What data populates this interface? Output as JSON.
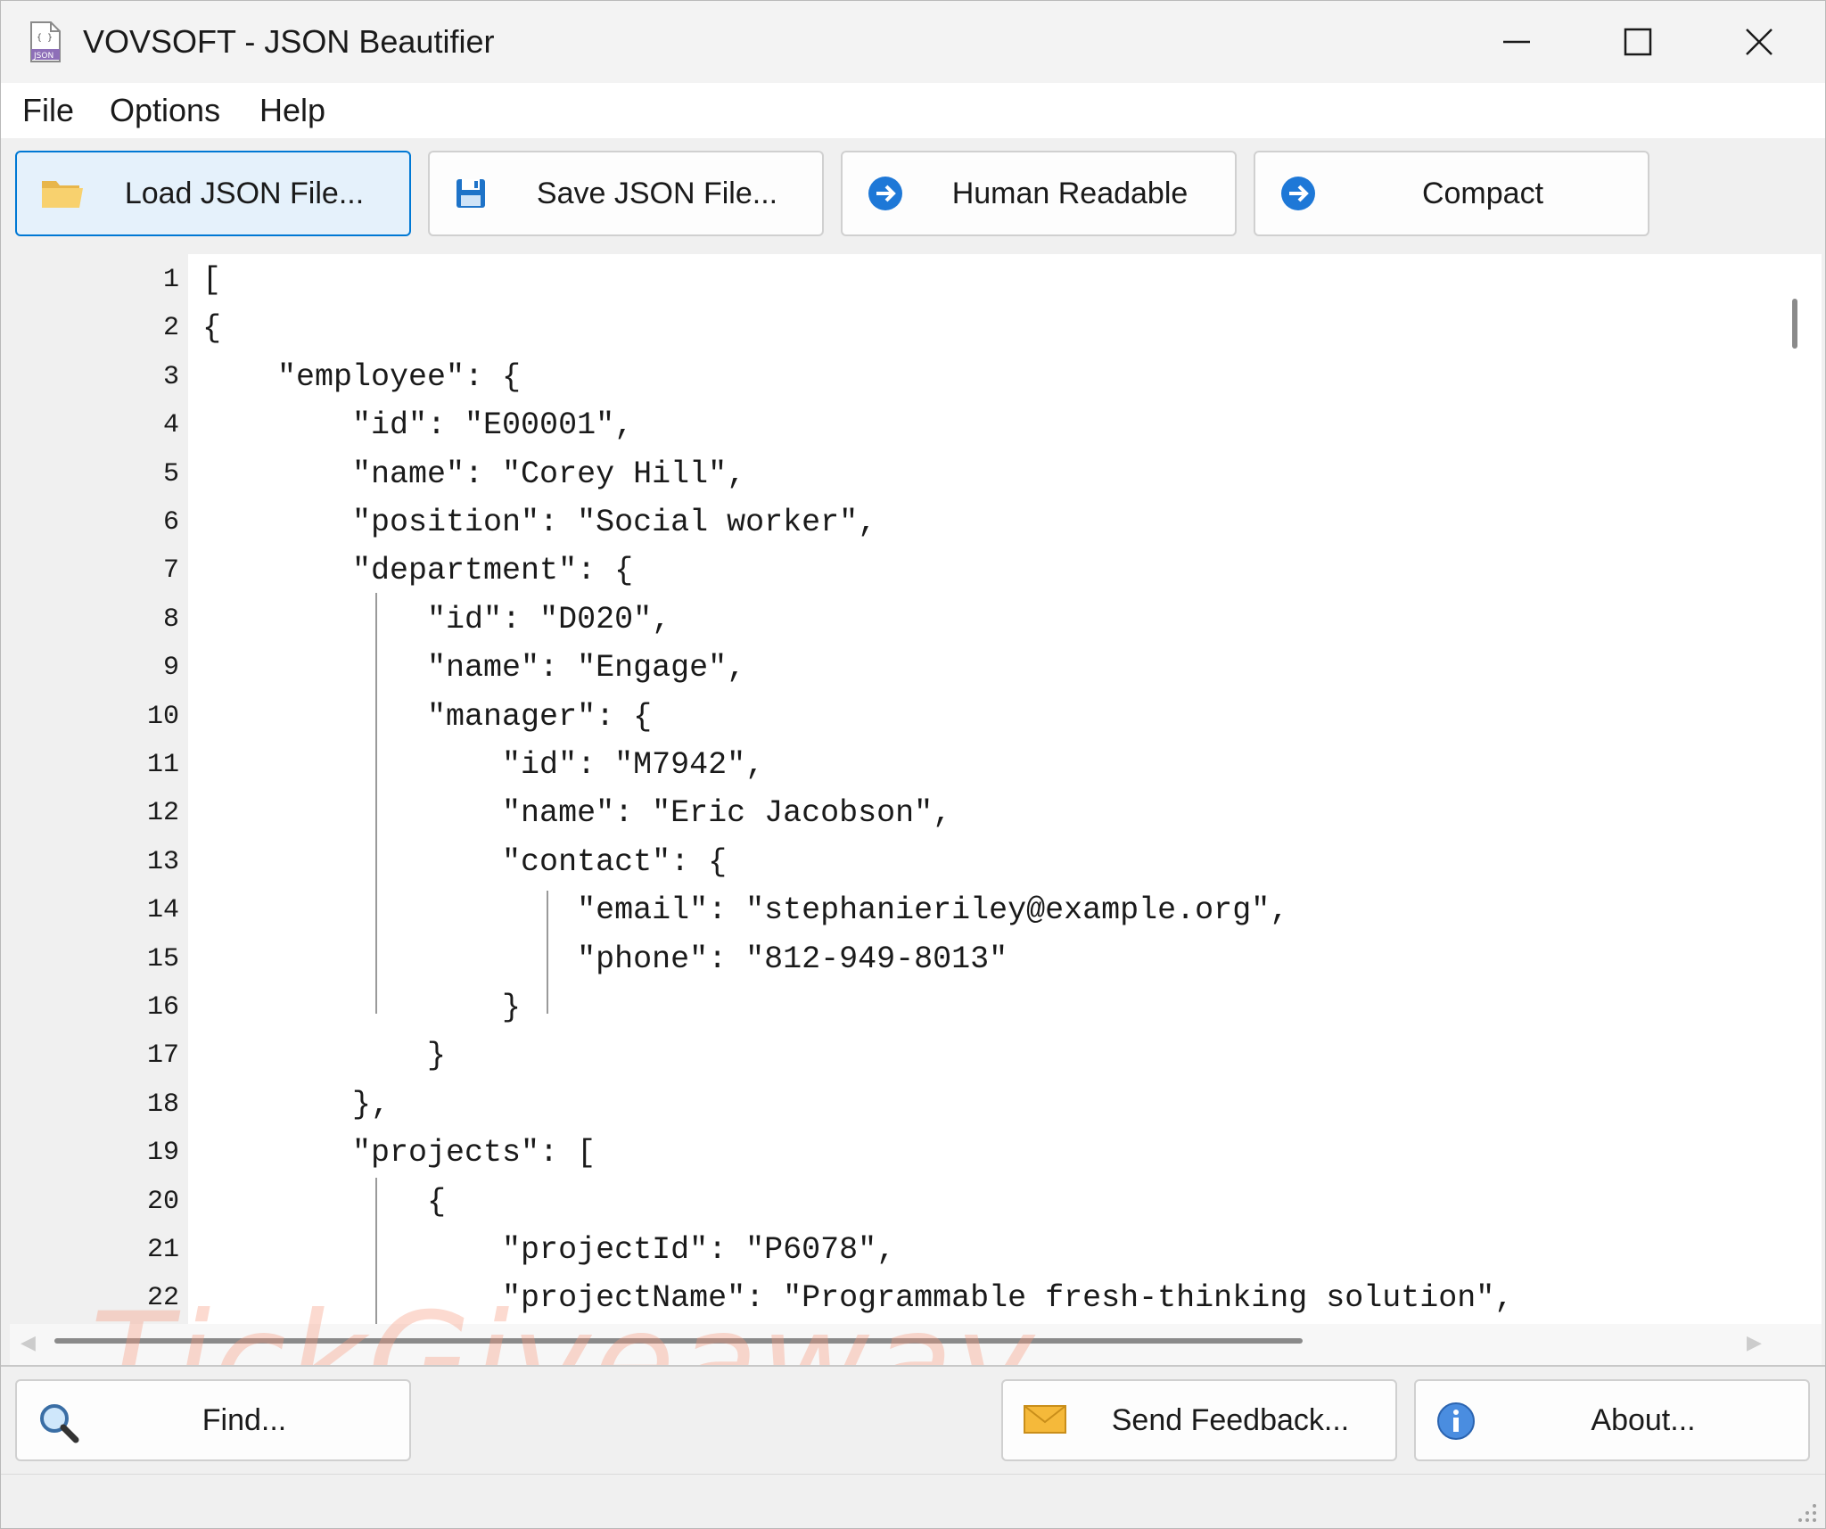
{
  "window": {
    "title": "VOVSOFT - JSON Beautifier",
    "icon": "json-file-icon",
    "controls": {
      "minimize": "minimize-icon",
      "maximize": "maximize-icon",
      "close": "close-icon"
    }
  },
  "menu": {
    "file": "File",
    "options": "Options",
    "help": "Help"
  },
  "toolbar": {
    "load_label": "Load JSON File...",
    "save_label": "Save JSON File...",
    "human_readable_label": "Human Readable",
    "compact_label": "Compact",
    "load_icon": "folder-icon",
    "save_icon": "floppy-disk-icon",
    "human_readable_icon": "arrow-right-circle-icon",
    "compact_icon": "arrow-right-circle-icon"
  },
  "editor": {
    "lines": [
      {
        "n": "1",
        "text": "["
      },
      {
        "n": "2",
        "text": "{"
      },
      {
        "n": "3",
        "text": "    \"employee\": {"
      },
      {
        "n": "4",
        "text": "        \"id\": \"E00001\","
      },
      {
        "n": "5",
        "text": "        \"name\": \"Corey Hill\","
      },
      {
        "n": "6",
        "text": "        \"position\": \"Social worker\","
      },
      {
        "n": "7",
        "text": "        \"department\": {"
      },
      {
        "n": "8",
        "text": "            \"id\": \"D020\","
      },
      {
        "n": "9",
        "text": "            \"name\": \"Engage\","
      },
      {
        "n": "10",
        "text": "            \"manager\": {"
      },
      {
        "n": "11",
        "text": "                \"id\": \"M7942\","
      },
      {
        "n": "12",
        "text": "                \"name\": \"Eric Jacobson\","
      },
      {
        "n": "13",
        "text": "                \"contact\": {"
      },
      {
        "n": "14",
        "text": "                    \"email\": \"stephanieriley@example.org\","
      },
      {
        "n": "15",
        "text": "                    \"phone\": \"812-949-8013\""
      },
      {
        "n": "16",
        "text": "                }"
      },
      {
        "n": "17",
        "text": "            }"
      },
      {
        "n": "18",
        "text": "        },"
      },
      {
        "n": "19",
        "text": "        \"projects\": ["
      },
      {
        "n": "20",
        "text": "            {"
      },
      {
        "n": "21",
        "text": "                \"projectId\": \"P6078\","
      },
      {
        "n": "22",
        "text": "                \"projectName\": \"Programmable fresh-thinking solution\","
      }
    ]
  },
  "bottom": {
    "find_label": "Find...",
    "feedback_label": "Send Feedback...",
    "about_label": "About...",
    "find_icon": "magnifier-icon",
    "feedback_icon": "envelope-icon",
    "about_icon": "info-icon"
  },
  "watermark": "TickGiveaway",
  "colors": {
    "accent": "#0078d4",
    "icon_blue": "#1e78d7",
    "folder_yellow": "#f5c75a",
    "watermark": "#f59678"
  }
}
